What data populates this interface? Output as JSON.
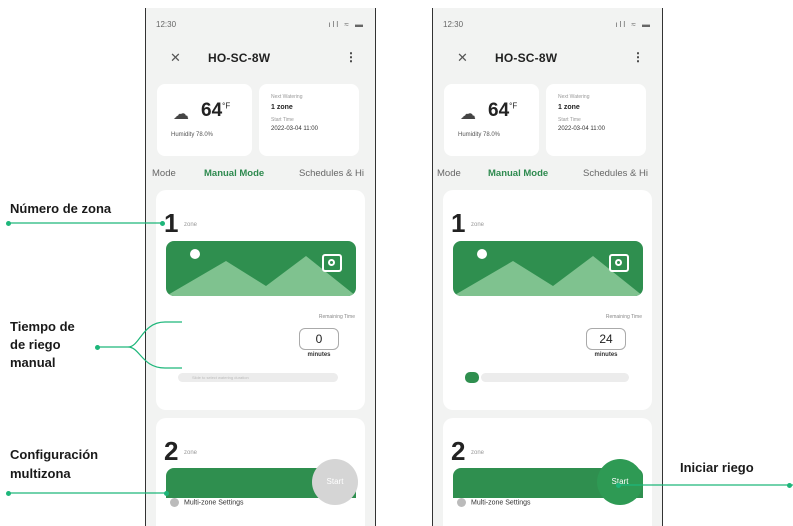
{
  "phone_left": {
    "status_time": "12:30",
    "status_icons": "ıll ≈ ▬",
    "device_name": "HO-SC-8W",
    "weather": {
      "temp": "64",
      "unit": "°F",
      "humidity": "Humidity  78.0%"
    },
    "next_watering": {
      "label": "Next Watering",
      "zone": "1 zone",
      "start_label": "Start Time",
      "start_time": "2022-03-04 11:00"
    },
    "tabs": [
      "Mode",
      "Manual Mode",
      "Schedules & Hi"
    ],
    "zone1": {
      "number": "1",
      "label": "zone",
      "remaining_label": "Remaining Time",
      "remaining_value": "0",
      "remaining_unit": "minutes",
      "bar_hint": "Slide to select watering duration"
    },
    "zone2": {
      "number": "2",
      "label": "zone"
    },
    "multizone": "Multi-zone Settings",
    "start": "Start"
  },
  "phone_right": {
    "status_time": "12:30",
    "status_icons": "ıll ≈ ▬",
    "device_name": "HO-SC-8W",
    "weather": {
      "temp": "64",
      "unit": "°F",
      "humidity": "Humidity  78.0%"
    },
    "next_watering": {
      "label": "Next Watering",
      "zone": "1 zone",
      "start_label": "Start Time",
      "start_time": "2022-03-04 11:00"
    },
    "tabs": [
      "Mode",
      "Manual Mode",
      "Schedules & Hi"
    ],
    "zone1": {
      "number": "1",
      "label": "zone",
      "remaining_label": "Remaining Time",
      "remaining_value": "24",
      "remaining_unit": "minutes"
    },
    "zone2": {
      "number": "2",
      "label": "zone"
    },
    "multizone": "Multi-zone Settings",
    "start": "Start"
  },
  "callouts": {
    "zone_number": "Número de zona",
    "manual_time_l1": "Tiempo de",
    "manual_time_l2": "de riego",
    "manual_time_l3": "manual",
    "multizone_l1": "Configuración",
    "multizone_l2": "multizona",
    "start_watering": "Iniciar riego"
  },
  "colors": {
    "accent": "#2f8f4f",
    "callout_line": "#1db67a",
    "start_disabled": "#d5d5d5"
  },
  "icons": [
    "close-icon",
    "kebab-menu-icon",
    "cloud-icon",
    "camera-icon",
    "gear-icon",
    "signal-icon",
    "wifi-icon",
    "battery-icon"
  ]
}
